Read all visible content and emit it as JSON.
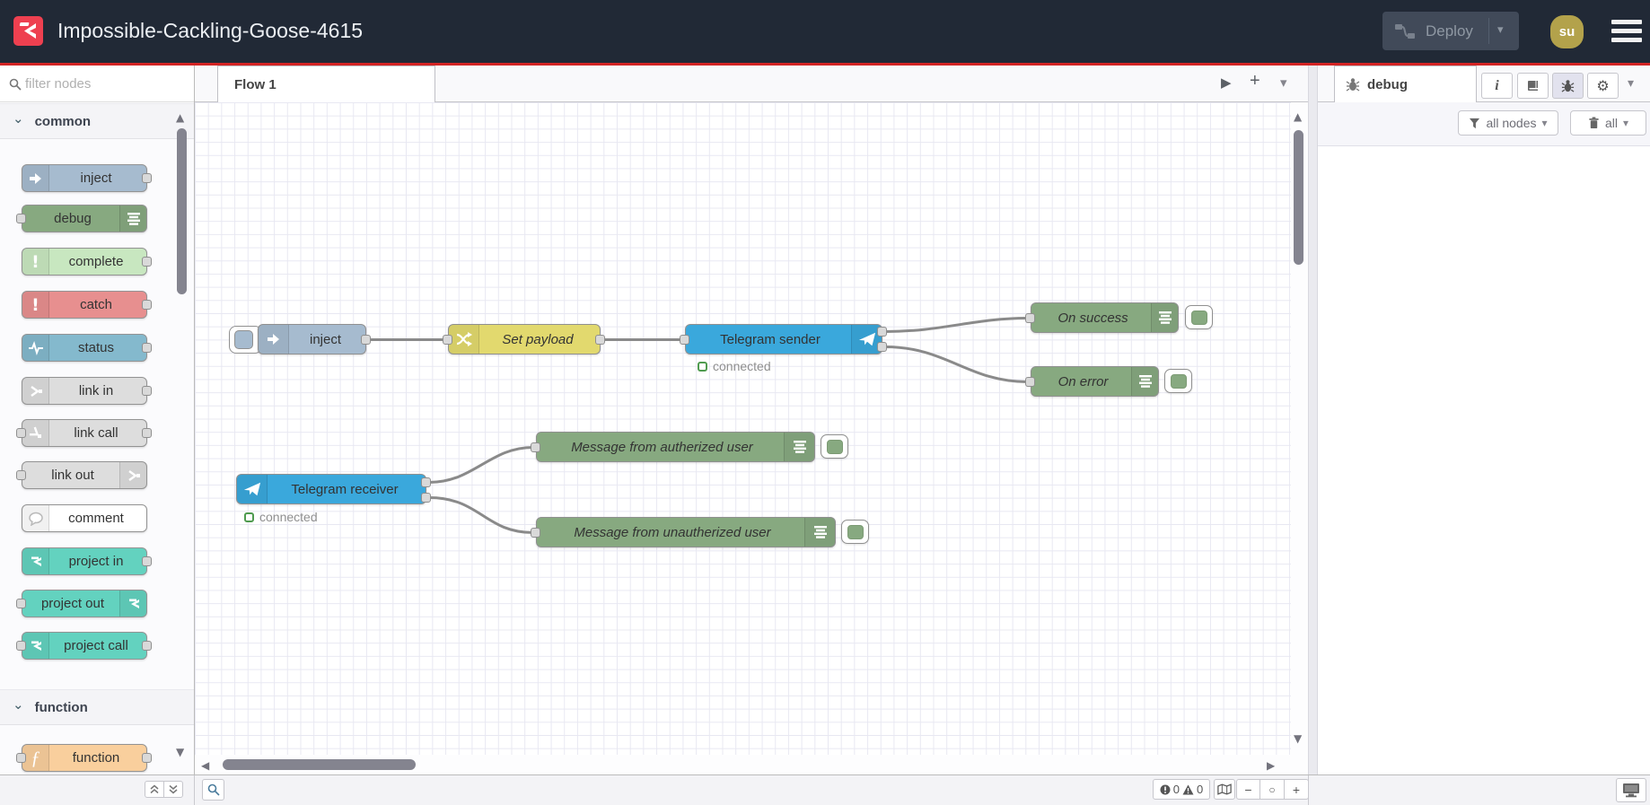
{
  "header": {
    "title": "Impossible-Cackling-Goose-4615",
    "deploy": {
      "label": "Deploy"
    },
    "user": {
      "initials": "su"
    }
  },
  "workspace": {
    "tab": "Flow 1"
  },
  "palette": {
    "search_placeholder": "filter nodes",
    "categories": [
      {
        "label": "common",
        "items": [
          {
            "label": "inject"
          },
          {
            "label": "debug"
          },
          {
            "label": "complete"
          },
          {
            "label": "catch"
          },
          {
            "label": "status"
          },
          {
            "label": "link in"
          },
          {
            "label": "link call"
          },
          {
            "label": "link out"
          },
          {
            "label": "comment"
          },
          {
            "label": "project in"
          },
          {
            "label": "project out"
          },
          {
            "label": "project call"
          }
        ]
      },
      {
        "label": "function",
        "items": [
          {
            "label": "function"
          }
        ]
      }
    ]
  },
  "flow": {
    "nodes": [
      {
        "label": "inject"
      },
      {
        "label": "Set payload"
      },
      {
        "label": "Telegram sender",
        "status": "connected"
      },
      {
        "label": "On success"
      },
      {
        "label": "On error"
      },
      {
        "label": "Telegram receiver",
        "status": "connected"
      },
      {
        "label": "Message from autherized user"
      },
      {
        "label": "Message from unautherized user"
      }
    ]
  },
  "sidebar": {
    "tab": "debug",
    "filter_label": "all nodes",
    "clear_label": "all"
  },
  "statusbar": {
    "errors": "0",
    "warnings": "0"
  },
  "colors": {
    "header_bg": "#212936",
    "accent_red": "#d32424",
    "logo_red": "#ee4050",
    "node_inject": "#a6bbcf",
    "node_debug": "#87a980",
    "node_complete": "#c8e7c0",
    "node_catch": "#e78f8f",
    "node_status": "#84b9cd",
    "node_link": "#dddddd",
    "node_comment": "#ffffff",
    "node_project": "#63d2bf",
    "node_function": "#f9cf9d",
    "node_telegram": "#3aa8dc",
    "node_change": "#e2d96e",
    "status_green": "#4f9b4f"
  },
  "icons": [
    "flowfuse-logo",
    "deploy-icon",
    "menu-icon",
    "search-icon",
    "inject-arrow-icon",
    "debug-lines-icon",
    "exclamation-icon",
    "status-wave-icon",
    "link-icon",
    "comment-bubble-icon",
    "project-icon",
    "function-icon",
    "change-shuffle-icon",
    "telegram-plane-icon",
    "info-icon",
    "book-icon",
    "bug-icon",
    "gear-icon",
    "funnel-icon",
    "trash-icon",
    "map-icon",
    "monitor-icon",
    "error-circle-icon",
    "warning-triangle-icon"
  ],
  "glyphs": {
    "chevron_down": "⌄",
    "caret_down": "▾",
    "play": "▶",
    "plus": "+",
    "scroll_up": "▲",
    "scroll_down": "▼",
    "scroll_left": "◀",
    "scroll_right": "▶",
    "zoom_out": "−",
    "zoom_reset": "○",
    "zoom_in": "+",
    "info": "i",
    "gear": "⚙"
  }
}
